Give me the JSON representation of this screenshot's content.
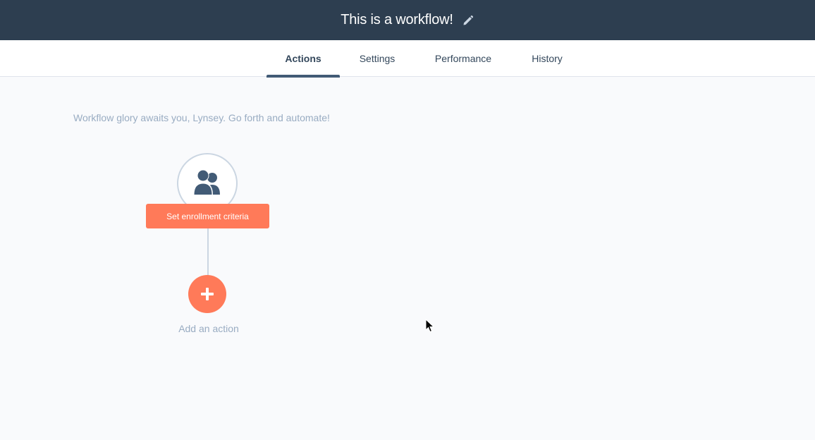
{
  "header": {
    "title": "This is a workflow!",
    "edit_icon": "pencil-icon",
    "background": "#2d3e50"
  },
  "tabs": [
    {
      "label": "Actions",
      "active": true
    },
    {
      "label": "Settings",
      "active": false
    },
    {
      "label": "Performance",
      "active": false
    },
    {
      "label": "History",
      "active": false
    }
  ],
  "main": {
    "welcome_text": "Workflow glory awaits you, Lynsey. Go forth and automate!",
    "enrollment": {
      "icon": "contacts-group-icon",
      "button_label": "Set enrollment criteria"
    },
    "add_action": {
      "icon": "plus-icon",
      "label": "Add an action"
    }
  },
  "colors": {
    "accent": "#ff7a59",
    "tab_indicator": "#425b76",
    "muted_text": "#99acc2"
  }
}
